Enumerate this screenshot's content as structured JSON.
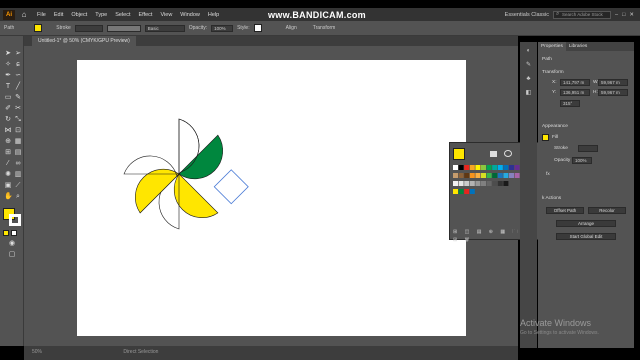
{
  "app": {
    "logo": "Ai",
    "home_icon": "home-icon"
  },
  "menu": [
    "File",
    "Edit",
    "Object",
    "Type",
    "Select",
    "Effect",
    "View",
    "Window",
    "Help"
  ],
  "workspace_name": "Essentials Classic",
  "search_placeholder": "Search Adobe Stock",
  "watermark": "www.BANDICAM.com",
  "control": {
    "selection": "Path",
    "fill_color": "#ffe600",
    "stroke_label": "Stroke",
    "brush_label": "Basic",
    "opacity_label": "Opacity:",
    "opacity_value": "100%",
    "style_label": "Style:",
    "align_label": "Align",
    "transform_label": "Transform"
  },
  "document_tab": "Untitled-1* @ 50% (CMYK/GPU Preview)",
  "properties": {
    "tabs": [
      "Properties",
      "Libraries"
    ],
    "selection": "Path",
    "transform_label": "Transform",
    "x_label": "X:",
    "x_value": "141,797 m",
    "y_label": "Y:",
    "y_value": "136,951 m",
    "w_label": "W:",
    "w_value": "59,967 m",
    "h_label": "H:",
    "h_value": "59,967 m",
    "angle_value": "315°",
    "appearance_label": "Appearance",
    "fill_label": "Fill",
    "stroke_label": "Stroke",
    "opacity_label": "Opacity",
    "opacity_value": "100%",
    "fx_label": "fx",
    "quick_actions_label": "k Actions",
    "offset_path": "Offset Path",
    "recolor": "Recolor",
    "arrange": "Arrange",
    "start_global_edit": "Start Global Edit"
  },
  "status_bar": {
    "zoom": "50%",
    "tool": "Direct Selection"
  },
  "windows_activation": {
    "title": "Activate Windows",
    "subtitle": "Go to Settings to activate Windows."
  },
  "colors": {
    "yellow": "#ffe600",
    "green": "#00873e"
  }
}
